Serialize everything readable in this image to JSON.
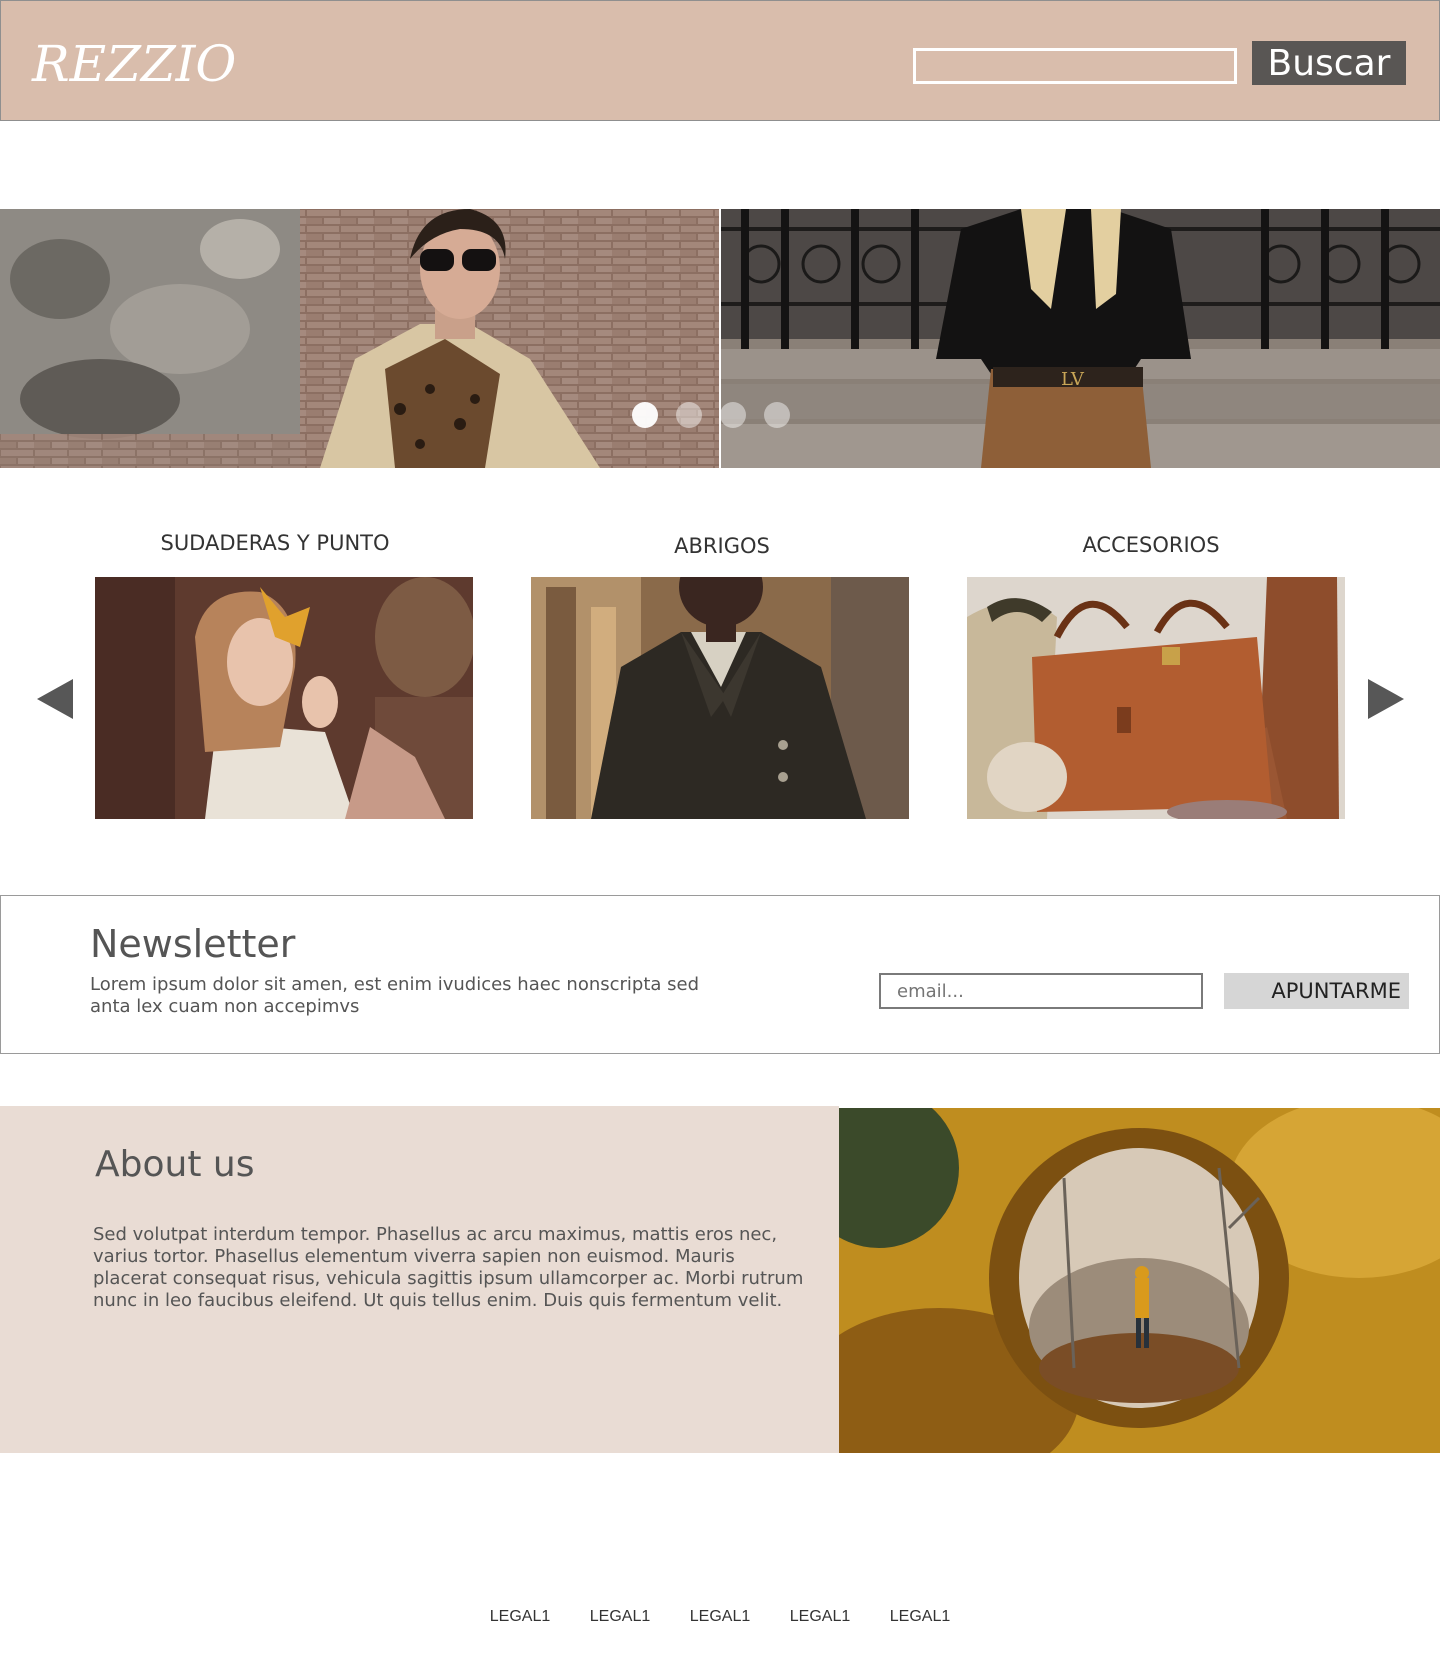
{
  "header": {
    "logo": "REZZIO",
    "search_placeholder": "",
    "search_button": "Buscar"
  },
  "hero": {
    "slide_count": 4,
    "active_slide": 1
  },
  "categories": {
    "items": [
      {
        "title": "SUDADERAS Y PUNTO"
      },
      {
        "title": "ABRIGOS"
      },
      {
        "title": "ACCESORIOS"
      }
    ]
  },
  "newsletter": {
    "title": "Newsletter",
    "text": "Lorem ipsum dolor sit amen, est enim ivudices haec nonscripta sed anta lex cuam non accepimvs",
    "email_placeholder": "email...",
    "button": "APUNTARME"
  },
  "about": {
    "title": "About us",
    "text": "Sed volutpat interdum tempor. Phasellus ac arcu maximus, mattis eros nec, varius tortor. Phasellus elementum viverra sapien non euismod. Mauris placerat consequat risus, vehicula sagittis ipsum ullamcorper ac. Morbi rutrum nunc in leo faucibus eleifend. Ut quis tellus enim. Duis quis fermentum velit."
  },
  "footer": {
    "links": [
      "LEGAL1",
      "LEGAL1",
      "LEGAL1",
      "LEGAL1",
      "LEGAL1"
    ]
  },
  "colors": {
    "header_bg": "#d9bdac",
    "about_bg": "#e9dcd4",
    "button_dark": "#595654"
  }
}
